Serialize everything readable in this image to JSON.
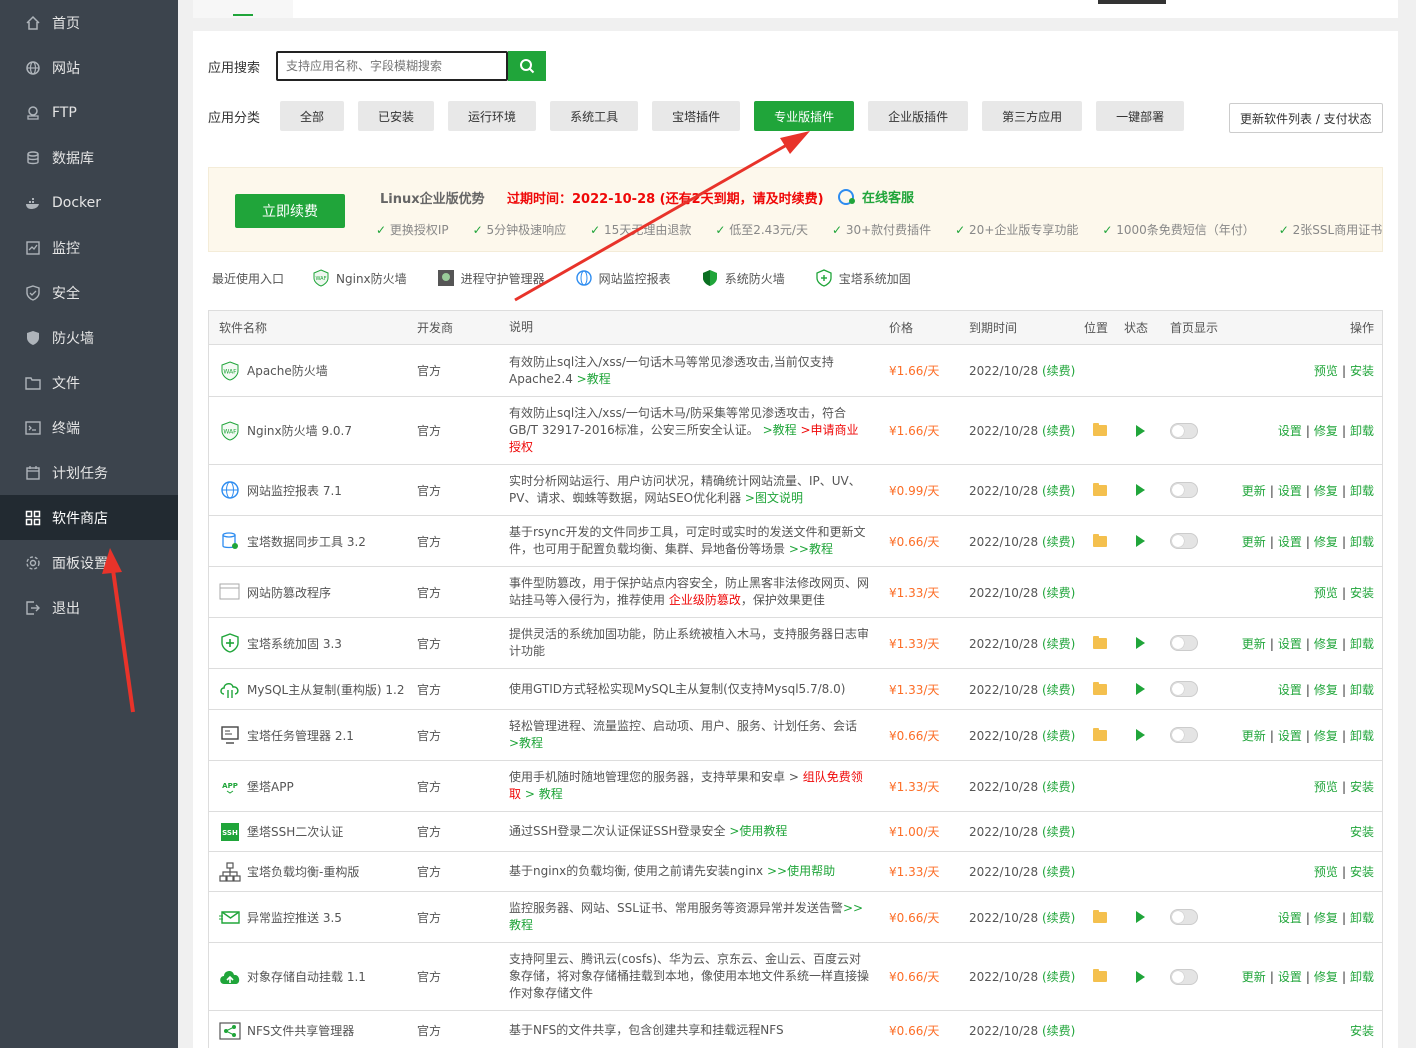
{
  "sidebar": {
    "items": [
      {
        "label": "首页",
        "icon": "home-icon"
      },
      {
        "label": "网站",
        "icon": "globe-icon"
      },
      {
        "label": "FTP",
        "icon": "ftp-icon"
      },
      {
        "label": "数据库",
        "icon": "database-icon"
      },
      {
        "label": "Docker",
        "icon": "docker-icon"
      },
      {
        "label": "监控",
        "icon": "monitor-icon"
      },
      {
        "label": "安全",
        "icon": "shield-icon"
      },
      {
        "label": "防火墙",
        "icon": "firewall-icon"
      },
      {
        "label": "文件",
        "icon": "folder-icon"
      },
      {
        "label": "终端",
        "icon": "terminal-icon"
      },
      {
        "label": "计划任务",
        "icon": "calendar-icon"
      },
      {
        "label": "软件商店",
        "icon": "grid-icon",
        "active": true
      },
      {
        "label": "面板设置",
        "icon": "settings-icon"
      },
      {
        "label": "退出",
        "icon": "logout-icon"
      }
    ]
  },
  "search": {
    "label": "应用搜索",
    "placeholder": "支持应用名称、字段模糊搜索"
  },
  "categories": {
    "label": "应用分类",
    "items": [
      "全部",
      "已安装",
      "运行环境",
      "系统工具",
      "宝塔插件",
      "专业版插件",
      "企业版插件",
      "第三方应用",
      "一键部署"
    ],
    "active": "专业版插件",
    "update_label": "更新软件列表 / 支付状态"
  },
  "promo": {
    "renew_label": "立即续费",
    "title": "Linux企业版优势",
    "expire": "过期时间：2022-10-28 (还有2天到期，请及时续费)",
    "service": "在线客服",
    "features": [
      "更换授权IP",
      "5分钟极速响应",
      "15天无理由退款",
      "低至2.43元/天",
      "30+款付费插件",
      "20+企业版专享功能",
      "1000条免费短信（年付）",
      "2张SSL商用证书"
    ]
  },
  "recent": {
    "label": "最近使用入口",
    "items": [
      "Nginx防火墙",
      "进程守护管理器",
      "网站监控报表",
      "系统防火墙",
      "宝塔系统加固"
    ]
  },
  "table": {
    "headers": {
      "name": "软件名称",
      "dev": "开发商",
      "desc": "说明",
      "price": "价格",
      "expire": "到期时间",
      "pos": "位置",
      "status": "状态",
      "home": "首页显示",
      "op": "操作"
    },
    "renew_text": "(续费)",
    "rows": [
      {
        "name": "Apache防火墙",
        "dev": "官方",
        "desc": "有效防止sql注入/xss/一句话木马等常见渗透攻击,当前仅支持Apache2.4 ",
        "link": ">教程",
        "price": "¥1.66/天",
        "date": "2022/10/28 ",
        "installed": false,
        "ops": [
          "预览",
          "安装"
        ],
        "icon": "waf-icon",
        "h": 52
      },
      {
        "name": "Nginx防火墙 9.0.7",
        "dev": "官方",
        "desc": "有效防止sql注入/xss/一句话木马/防采集等常见渗透攻击，符合GB/T 32917-2016标准，公安三所安全认证。 ",
        "link": ">教程",
        "link2": " >申请商业授权",
        "price": "¥1.66/天",
        "date": "2022/10/28 ",
        "installed": true,
        "ops": [
          "设置",
          "修复",
          "卸载"
        ],
        "icon": "waf-icon",
        "h": 68
      },
      {
        "name": "网站监控报表 7.1",
        "dev": "官方",
        "desc": "实时分析网站运行、用户访问状况，精确统计网站流量、IP、UV、PV、请求、蜘蛛等数据，网站SEO优化利器 ",
        "link": ">图文说明",
        "price": "¥0.99/天",
        "date": "2022/10/28 ",
        "installed": true,
        "ops": [
          "更新",
          "设置",
          "修复",
          "卸载"
        ],
        "icon": "globe-monitor-icon",
        "h": 51
      },
      {
        "name": "宝塔数据同步工具 3.2",
        "dev": "官方",
        "desc": "基于rsync开发的文件同步工具，可定时或实时的发送文件和更新文件，也可用于配置负载均衡、集群、异地备份等场景 ",
        "link": ">>教程",
        "price": "¥0.66/天",
        "date": "2022/10/28 ",
        "installed": true,
        "ops": [
          "更新",
          "设置",
          "修复",
          "卸载"
        ],
        "icon": "db-sync-icon",
        "h": 51
      },
      {
        "name": "网站防篡改程序",
        "dev": "官方",
        "desc": "事件型防篡改，用于保护站点内容安全，防止黑客非法修改网页、网站挂马等入侵行为，推荐使用 ",
        "link_red": "企业级防篡改",
        "desc_tail": "，保护效果更佳",
        "price": "¥1.33/天",
        "date": "2022/10/28 ",
        "installed": false,
        "ops": [
          "预览",
          "安装"
        ],
        "icon": "tamper-icon",
        "h": 51
      },
      {
        "name": "宝塔系统加固 3.3",
        "dev": "官方",
        "desc": "提供灵活的系统加固功能，防止系统被植入木马，支持服务器日志审计功能",
        "price": "¥1.33/天",
        "date": "2022/10/28 ",
        "installed": true,
        "ops": [
          "更新",
          "设置",
          "修复",
          "卸载"
        ],
        "icon": "shield-plus-icon",
        "h": 51
      },
      {
        "name": "MySQL主从复制(重构版) 1.2",
        "dev": "官方",
        "desc": "使用GTID方式轻松实现MySQL主从复制(仅支持Mysql5.7/8.0)",
        "price": "¥1.33/天",
        "date": "2022/10/28 ",
        "installed": true,
        "ops": [
          "设置",
          "修复",
          "卸载"
        ],
        "icon": "cloud-sync-icon",
        "h": 41
      },
      {
        "name": "宝塔任务管理器 2.1",
        "dev": "官方",
        "desc": "轻松管理进程、流量监控、启动项、用户、服务、计划任务、会话 ",
        "link": ">教程",
        "price": "¥0.66/天",
        "date": "2022/10/28 ",
        "installed": true,
        "ops": [
          "更新",
          "设置",
          "修复",
          "卸载"
        ],
        "icon": "task-icon",
        "h": 51
      },
      {
        "name": "堡塔APP",
        "dev": "官方",
        "desc": "使用手机随时随地管理您的服务器，支持苹果和安卓 > ",
        "link_red": "组队免费领取",
        "link": " > 教程",
        "price": "¥1.33/天",
        "date": "2022/10/28 ",
        "installed": false,
        "ops": [
          "预览",
          "安装"
        ],
        "icon": "app-icon",
        "h": 51
      },
      {
        "name": "堡塔SSH二次认证",
        "dev": "官方",
        "desc": "通过SSH登录二次认证保证SSH登录安全 ",
        "link": ">使用教程",
        "price": "¥1.00/天",
        "date": "2022/10/28 ",
        "installed": false,
        "ops": [
          "安装"
        ],
        "icon": "ssh-icon",
        "h": 40
      },
      {
        "name": "宝塔负载均衡-重构版",
        "dev": "官方",
        "desc": "基于nginx的负载均衡, 使用之前请先安装nginx ",
        "link": ">>使用帮助",
        "price": "¥1.33/天",
        "date": "2022/10/28 ",
        "installed": false,
        "ops": [
          "预览",
          "安装"
        ],
        "icon": "balance-icon",
        "h": 40
      },
      {
        "name": "异常监控推送 3.5",
        "dev": "官方",
        "desc": "监控服务器、网站、SSL证书、常用服务等资源异常并发送告警",
        "link": ">>教程",
        "price": "¥0.66/天",
        "date": "2022/10/28 ",
        "installed": true,
        "ops": [
          "设置",
          "修复",
          "卸载"
        ],
        "icon": "push-icon",
        "h": 51
      },
      {
        "name": "对象存储自动挂载 1.1",
        "dev": "官方",
        "desc": "支持阿里云、腾讯云(cosfs)、华为云、京东云、金山云、百度云对象存储，将对象存储桶挂载到本地，像使用本地文件系统一样直接操作对象存储文件",
        "price": "¥0.66/天",
        "date": "2022/10/28 ",
        "installed": true,
        "ops": [
          "更新",
          "设置",
          "修复",
          "卸载"
        ],
        "icon": "cloud-upload-icon",
        "h": 68
      },
      {
        "name": "NFS文件共享管理器",
        "dev": "官方",
        "desc": "基于NFS的文件共享，包含创建共享和挂载远程NFS",
        "price": "¥0.66/天",
        "date": "2022/10/28 ",
        "installed": false,
        "ops": [
          "安装"
        ],
        "icon": "share-icon",
        "h": 40
      }
    ]
  },
  "colors": {
    "accent": "#20a53a",
    "sidebar": "#3c444d",
    "sidebar_active": "#222a31",
    "price": "#fc6d26",
    "warning": "#ef0808",
    "annotation": "#e8332a"
  }
}
